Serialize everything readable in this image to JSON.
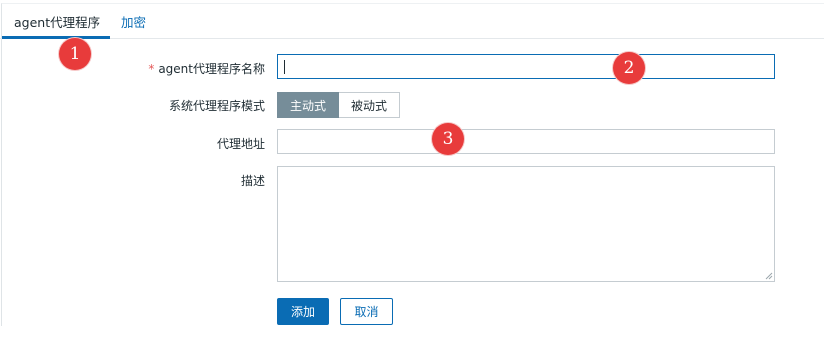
{
  "tabs": [
    {
      "label": "agent代理程序"
    },
    {
      "label": "加密"
    }
  ],
  "form": {
    "name_label": "agent代理程序名称",
    "name_value": "",
    "mode_label": "系统代理程序模式",
    "mode_options": [
      "主动式",
      "被动式"
    ],
    "mode_selected": "主动式",
    "address_label": "代理地址",
    "address_value": "",
    "description_label": "描述",
    "description_value": ""
  },
  "buttons": {
    "add": "添加",
    "cancel": "取消"
  },
  "annotations": [
    "1",
    "2",
    "3"
  ],
  "colors": {
    "accent": "#0a6cb4",
    "badge": "#e83b3b",
    "segment_active": "#768d99"
  }
}
